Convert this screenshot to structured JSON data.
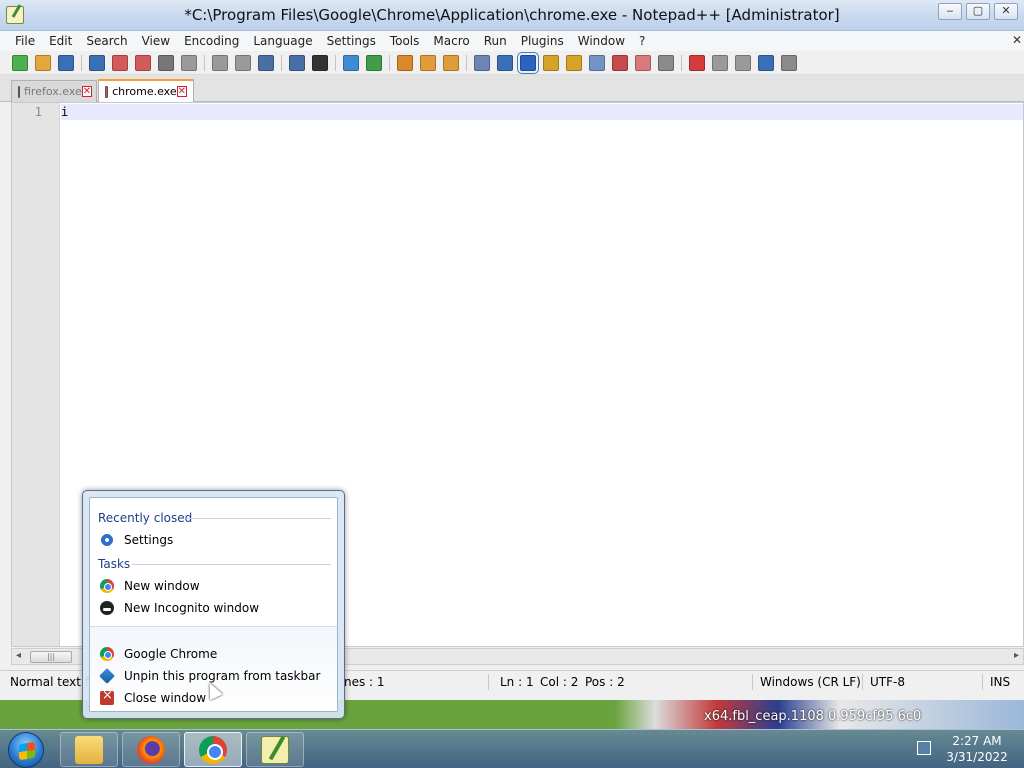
{
  "window": {
    "title": "*C:\\Program Files\\Google\\Chrome\\Application\\chrome.exe - Notepad++ [Administrator]",
    "minimize": "‒",
    "maximize": "▢",
    "close": "✕"
  },
  "menu": {
    "items": [
      "File",
      "Edit",
      "Search",
      "View",
      "Encoding",
      "Language",
      "Settings",
      "Tools",
      "Macro",
      "Run",
      "Plugins",
      "Window",
      "?"
    ],
    "close_glyph": "✕"
  },
  "toolbar": {
    "icon_colors": [
      "#4caf50",
      "#e6a63c",
      "#3a6fb6",
      "#3a6fb6",
      "#d35b5b",
      "#d35b5b",
      "#777777",
      "#9a9a9a",
      "#9a9a9a",
      "#9a9a9a",
      "#4a6fa5",
      "#4a6fa5",
      "#333333",
      "#3f8bd1",
      "#3f9d4b",
      "#d9892b",
      "#e09b3a",
      "#e09b3a",
      "#6a86b5",
      "#3a6fb6",
      "#2b62c4",
      "#d6a329",
      "#d6a329",
      "#7393c6",
      "#c94a4a",
      "#d97a7a",
      "#8a8a8a",
      "#d43c3c",
      "#9a9a9a",
      "#9a9a9a",
      "#3a6fb6",
      "#8a8a8a"
    ]
  },
  "tabs": [
    {
      "label": "firefox.exe",
      "close": "✕"
    },
    {
      "label": "chrome.exe",
      "close": "✕"
    }
  ],
  "editor": {
    "line_number": "1",
    "text": "i"
  },
  "scrollbar": {
    "left_arrow": "◂",
    "thumb_grip": "|||",
    "right_arrow": "▸"
  },
  "status": {
    "file_type": "Normal text fi",
    "lines": "nes : 1",
    "ln": "Ln : 1",
    "col": "Col : 2",
    "pos": "Pos : 2",
    "eol": "Windows (CR LF)",
    "encoding": "UTF-8",
    "mode": "INS"
  },
  "jumplist": {
    "recent_heading": "Recently closed",
    "recent_items": [
      {
        "label": "Settings",
        "icon": "gear-icon"
      }
    ],
    "tasks_heading": "Tasks",
    "task_items": [
      {
        "label": "New window",
        "icon": "chrome-icon"
      },
      {
        "label": "New Incognito window",
        "icon": "incognito-icon"
      }
    ],
    "program_items": [
      {
        "label": "Google Chrome",
        "icon": "chrome-icon"
      },
      {
        "label": "Unpin this program from taskbar",
        "icon": "pin-icon"
      },
      {
        "label": "Close window",
        "icon": "close-window-icon"
      }
    ]
  },
  "desktop": {
    "filename_text": "x64.fbl_ceap.1108          0.959cf95      6c0"
  },
  "taskbar": {
    "apps": [
      "file-explorer",
      "firefox",
      "chrome",
      "notepad-plus-plus"
    ],
    "time": "2:27 AM",
    "date": "3/31/2022"
  }
}
